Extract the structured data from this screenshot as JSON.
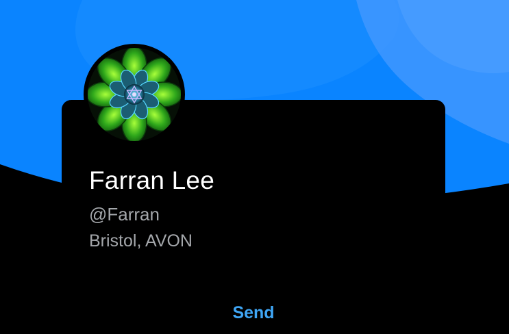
{
  "profile": {
    "name": "Farran Lee",
    "handle": "@Farran",
    "location": "Bristol, AVON",
    "avatar_icon": "mandala-avatar-icon"
  },
  "actions": {
    "send_label": "Send"
  },
  "colors": {
    "banner_blue": "#0a84ff",
    "card_background": "#000000",
    "primary_text": "#ffffff",
    "secondary_text": "#a4a7ab",
    "accent": "#3fa6f5"
  }
}
